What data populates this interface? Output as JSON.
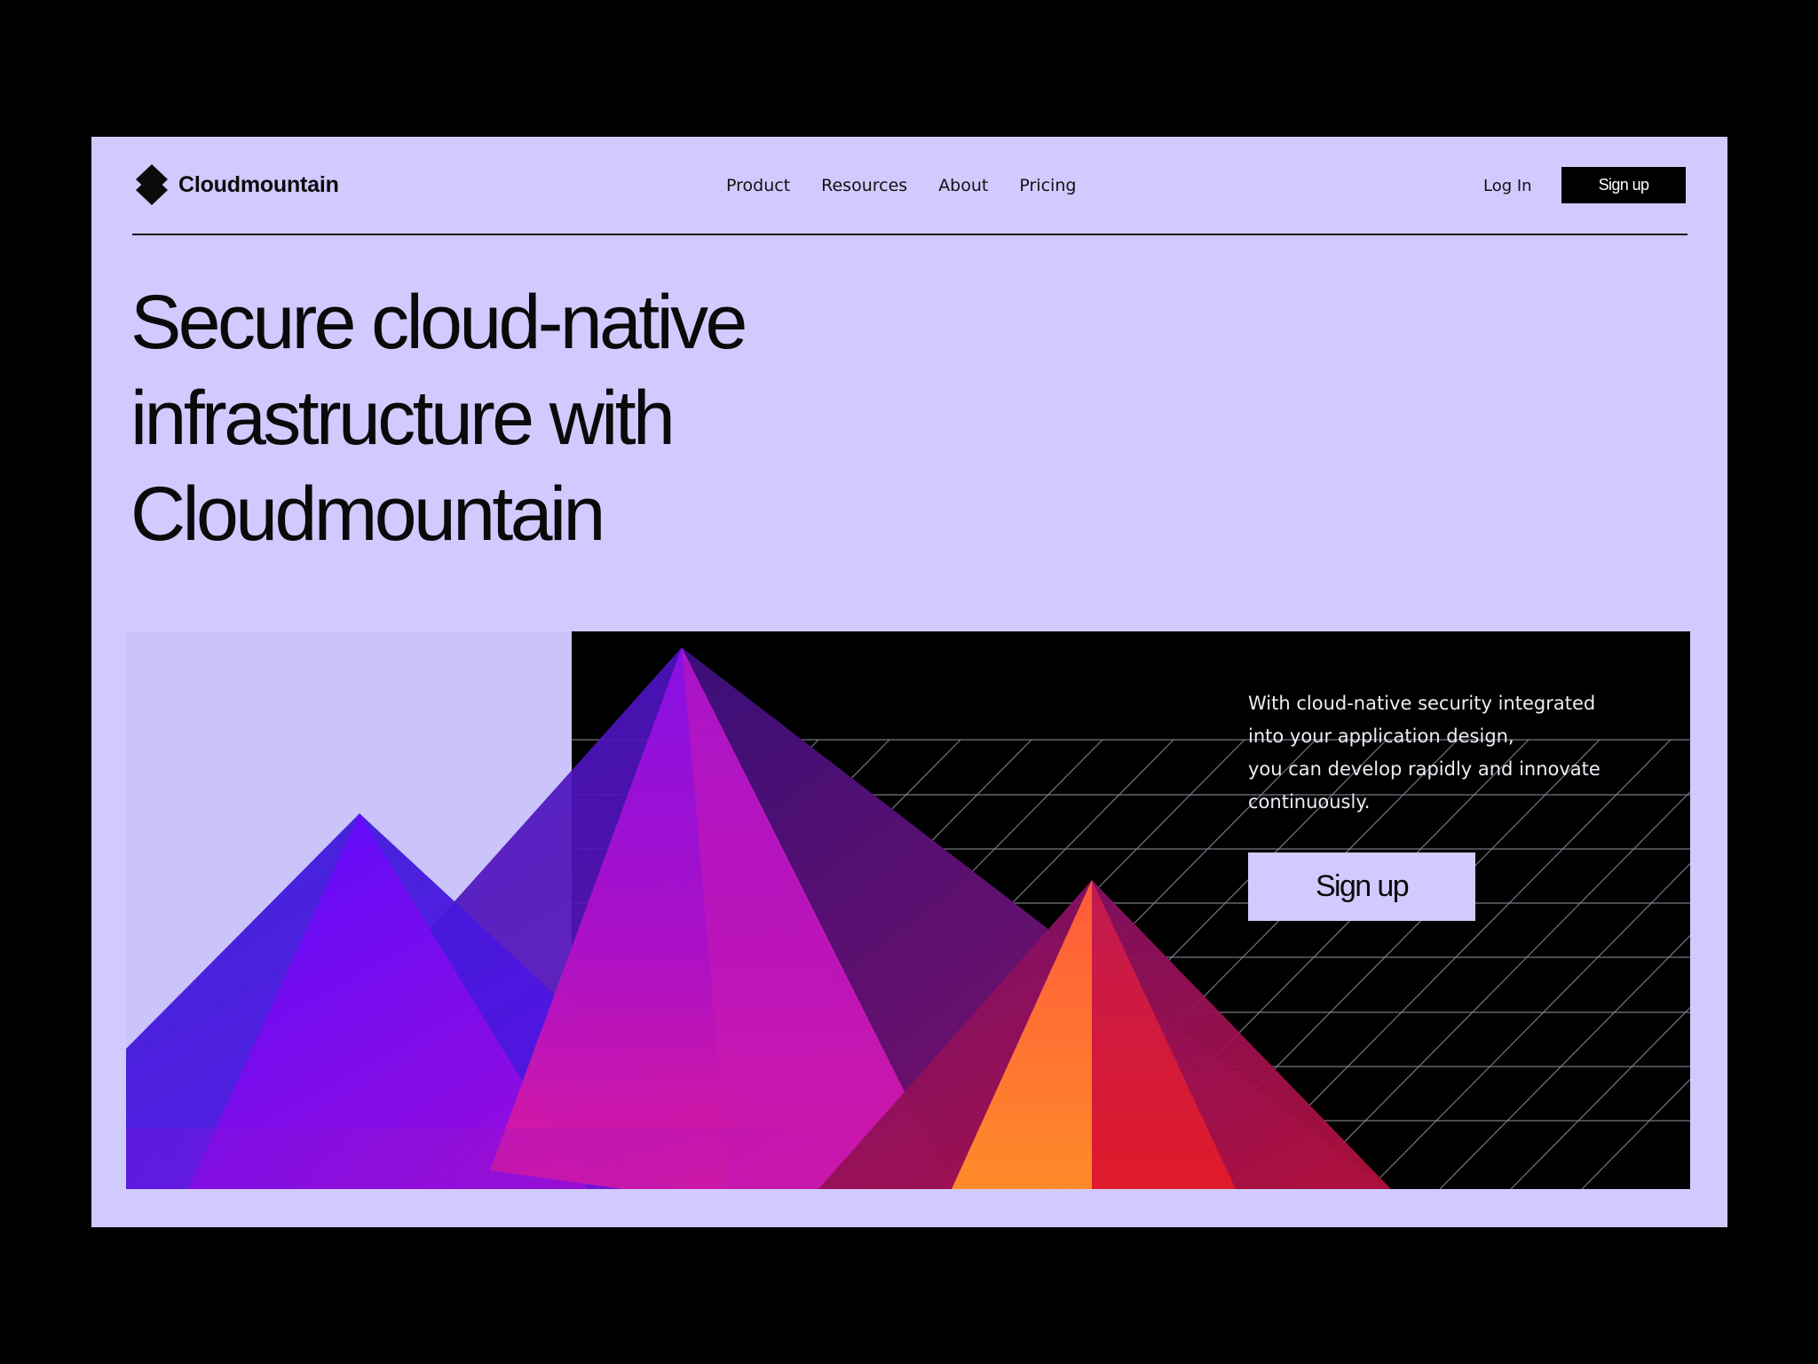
{
  "brand": {
    "name": "Cloudmountain",
    "logo_icon": "diamond-logo-icon"
  },
  "nav": {
    "items": [
      {
        "label": "Product"
      },
      {
        "label": "Resources"
      },
      {
        "label": "About"
      },
      {
        "label": "Pricing"
      }
    ]
  },
  "header_actions": {
    "login_label": "Log In",
    "signup_label": "Sign up"
  },
  "hero": {
    "headline_lines": [
      "Secure cloud-native",
      "infrastructure with",
      "Cloudmountain"
    ],
    "description_lines": [
      "With cloud-native security integrated",
      "into your application design,",
      "you can develop rapidly and innovate",
      "continuously."
    ],
    "cta_label": "Sign up",
    "illustration_icon": "gradient-mountains-illustration"
  },
  "colors": {
    "page_background": "#000000",
    "frame_background": "#d1caff",
    "text_dark": "#0a0a0a",
    "button_dark": "#000000",
    "panel_dark": "#000000",
    "mountain_gradient": [
      "#4a1fff",
      "#a010e8",
      "#e0207a",
      "#ff6a2a"
    ]
  }
}
